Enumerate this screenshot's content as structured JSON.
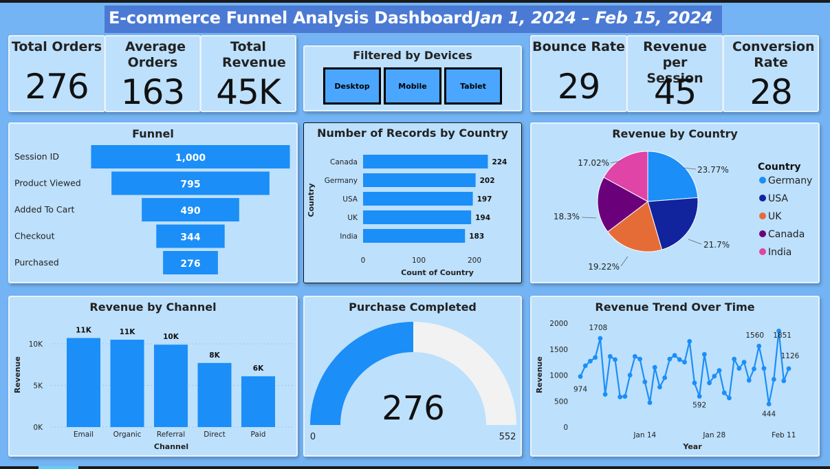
{
  "header": {
    "title": "E-commerce Funnel Analysis Dashboard",
    "date_range": "Jan 1, 2024 – Feb 15, 2024"
  },
  "kpis": {
    "total_orders": {
      "label": "Total Orders",
      "value": "276"
    },
    "average_orders": {
      "label": "Average Orders",
      "value": "163"
    },
    "total_revenue": {
      "label": "Total Revenue",
      "value": "45K"
    },
    "bounce_rate": {
      "label": "Bounce Rate",
      "value": "29"
    },
    "revenue_per_session": {
      "label": "Revenue per Session",
      "value": "45"
    },
    "conversion_rate": {
      "label": "Conversion Rate",
      "value": "28"
    }
  },
  "device_filter": {
    "title": "Filtered by Devices",
    "options": [
      "Desktop",
      "Mobile",
      "Tablet"
    ]
  },
  "colors": {
    "accent": "#1b8ef8",
    "background": "#74b4f4",
    "card": "#bde0fc",
    "header": "#4a7ad4",
    "gauge_empty": "#f2f2f2"
  },
  "chart_data": [
    {
      "id": "funnel",
      "type": "bar",
      "title": "Funnel",
      "categories": [
        "Session ID",
        "Product Viewed",
        "Added To Cart",
        "Checkout",
        "Purchased"
      ],
      "values": [
        1000,
        795,
        490,
        344,
        276
      ],
      "value_labels": [
        "1,000",
        "795",
        "490",
        "344",
        "276"
      ]
    },
    {
      "id": "records_by_country",
      "type": "bar",
      "title": "Number of Records by Country",
      "categories": [
        "Canada",
        "Germany",
        "USA",
        "UK",
        "India"
      ],
      "values": [
        224,
        202,
        197,
        194,
        183
      ],
      "xlabel": "Count of Country",
      "ylabel": "Country",
      "xticks": [
        0,
        100,
        200
      ],
      "xlim": [
        0,
        230
      ]
    },
    {
      "id": "revenue_by_country",
      "type": "pie",
      "title": "Revenue by Country",
      "legend_title": "Country",
      "legend": "right",
      "categories": [
        "Germany",
        "USA",
        "UK",
        "Canada",
        "India"
      ],
      "values": [
        23.77,
        21.7,
        19.22,
        18.3,
        17.02
      ],
      "value_labels": [
        "23.77%",
        "21.7%",
        "19.22%",
        "18.3%",
        "17.02%"
      ],
      "colors": [
        "#1b8ef8",
        "#12239e",
        "#e66c37",
        "#6b007b",
        "#e044a7"
      ]
    },
    {
      "id": "revenue_by_channel",
      "type": "bar",
      "title": "Revenue by Channel",
      "categories": [
        "Email",
        "Organic",
        "Referral",
        "Direct",
        "Paid"
      ],
      "values": [
        10700,
        10500,
        9900,
        7700,
        6100
      ],
      "value_labels": [
        "11K",
        "11K",
        "10K",
        "8K",
        "6K"
      ],
      "xlabel": "Channel",
      "ylabel": "Revenue",
      "yticks": [
        "0K",
        "5K",
        "10K"
      ],
      "ylim": [
        0,
        12000
      ],
      "grid": true
    },
    {
      "id": "purchase_completed",
      "type": "gauge",
      "title": "Purchase Completed",
      "value": 276,
      "min": 0,
      "max": 552,
      "value_label": "276",
      "min_label": "0",
      "max_label": "552"
    },
    {
      "id": "revenue_trend",
      "type": "line",
      "title": "Revenue Trend Over Time",
      "xlabel": "Year",
      "ylabel": "Revenue",
      "x_start": "2024-01-01",
      "x_ticks": [
        {
          "label": "Jan 14",
          "day": 13
        },
        {
          "label": "Jan 28",
          "day": 27
        },
        {
          "label": "Feb 11",
          "day": 41
        }
      ],
      "yticks": [
        0,
        500,
        1000,
        1500,
        2000
      ],
      "ylim": [
        0,
        2000
      ],
      "values": [
        974,
        1180,
        1270,
        1340,
        1708,
        630,
        1360,
        1300,
        580,
        590,
        1000,
        1360,
        1310,
        870,
        470,
        1150,
        770,
        950,
        1310,
        1380,
        1300,
        1250,
        1650,
        850,
        592,
        1400,
        850,
        980,
        1090,
        660,
        560,
        1310,
        1130,
        1250,
        900,
        1120,
        1560,
        1130,
        444,
        920,
        1851,
        890,
        1126
      ],
      "point_labels": [
        {
          "index": 0,
          "text": "974"
        },
        {
          "index": 4,
          "text": "1708"
        },
        {
          "index": 24,
          "text": "592"
        },
        {
          "index": 36,
          "text": "1560"
        },
        {
          "index": 38,
          "text": "444"
        },
        {
          "index": 40,
          "text": "1851"
        },
        {
          "index": 42,
          "text": "1126"
        }
      ]
    }
  ]
}
